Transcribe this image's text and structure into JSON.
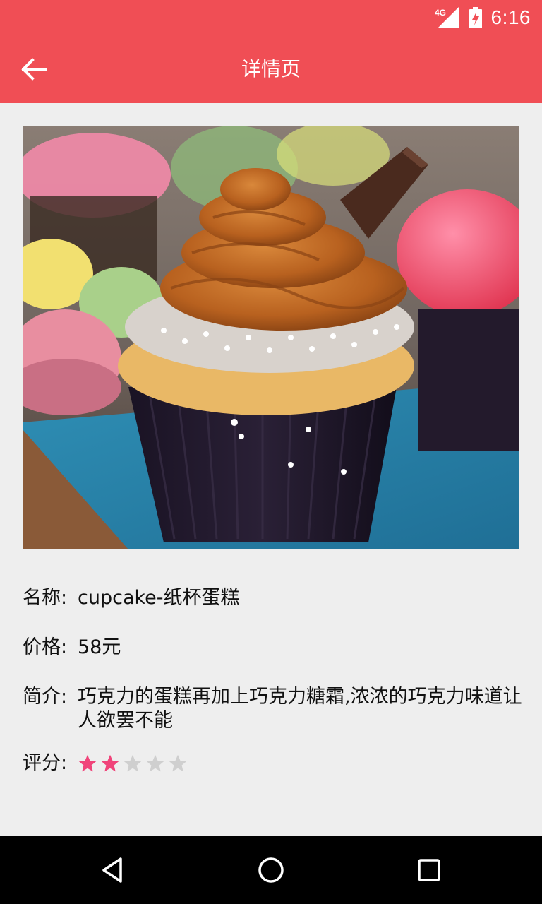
{
  "status_bar": {
    "network": "4G",
    "time": "6:16"
  },
  "app_bar": {
    "title": "详情页",
    "back_icon": "arrow-left-icon"
  },
  "hero_image": {
    "subject": "cupcake-photo"
  },
  "product": {
    "name_label": "名称:",
    "name_value": "cupcake-纸杯蛋糕",
    "price_label": "价格:",
    "price_value": "58元",
    "desc_label": "简介:",
    "desc_value": "巧克力的蛋糕再加上巧克力糖霜,浓浓的巧克力味道让人欲罢不能",
    "rating_label": "评分:",
    "rating": 2,
    "rating_max": 5
  },
  "colors": {
    "primary": "#F04E55",
    "star_active": "#F0447A",
    "star_inactive": "#CFCFCF",
    "background": "#EEEEEE"
  },
  "nav_bar": {
    "back_icon": "triangle-back-icon",
    "home_icon": "circle-home-icon",
    "recents_icon": "square-recents-icon"
  }
}
